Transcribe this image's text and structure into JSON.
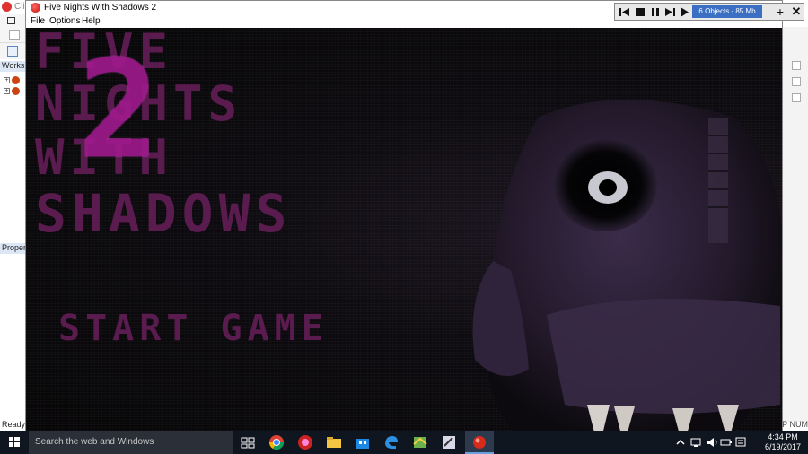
{
  "background_editor": {
    "title": "Cli",
    "panel_workspace": "Worksp",
    "panel_properties": "Propert",
    "status": "Ready",
    "right_status": "P NUM"
  },
  "game_window": {
    "title": "Five Nights With Shadows 2",
    "menu": [
      "File",
      "Options",
      "Help"
    ],
    "logo": {
      "line1": "FIVE",
      "line2": "NIGHTS",
      "line3": "WITH",
      "line4": "SHADOWS",
      "number": "2"
    },
    "start_button": "START GAME"
  },
  "debug_toolbar": {
    "objects_info": "6 Objects - 85 Mb",
    "plus": "+",
    "close": "✕"
  },
  "taskbar": {
    "search_placeholder": "Search the web and Windows",
    "clock_time": "4:34 PM",
    "clock_date": "6/19/2017"
  },
  "colors": {
    "logo_purple": "#5a1b4f",
    "logo_magenta": "#a01a8e",
    "taskbar": "#101620",
    "debug_blue": "#3b6fc4"
  }
}
